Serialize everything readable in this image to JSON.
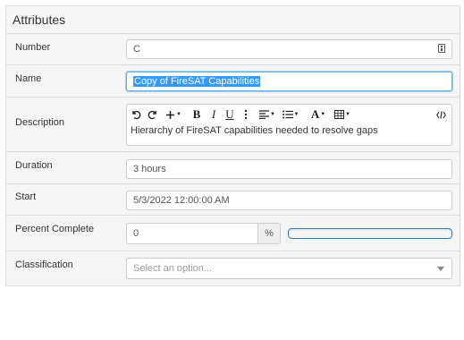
{
  "panel": {
    "title": "Attributes"
  },
  "fields": {
    "number": {
      "label": "Number",
      "value": "C"
    },
    "name": {
      "label": "Name",
      "value": "Copy of FireSAT Capabilities"
    },
    "description": {
      "label": "Description",
      "value": "Hierarchy of FireSAT capabilities needed to resolve gaps",
      "toolbar": [
        "undo-icon",
        "redo-icon",
        "insert-icon",
        "bold-icon",
        "italic-icon",
        "underline-icon",
        "more-vertical-icon",
        "align-icon",
        "list-icon",
        "font-color-icon",
        "table-icon",
        "code-view-icon"
      ]
    },
    "duration": {
      "label": "Duration",
      "value": "3 hours"
    },
    "start": {
      "label": "Start",
      "value": "5/3/2022 12:00:00 AM"
    },
    "percent": {
      "label": "Percent Complete",
      "value": "0",
      "unit": "%",
      "progress": 0
    },
    "classification": {
      "label": "Classification",
      "placeholder": "Select an option..."
    }
  },
  "colors": {
    "panel_bg": "#f5f5f5",
    "focus_border": "#66afe9",
    "selection": "#3399ff",
    "progress_border": "#337ab7"
  }
}
